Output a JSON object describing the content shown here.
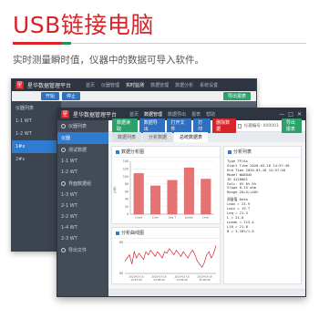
{
  "header": {
    "headline": "USB链接电脑",
    "subline": "实时测量瞬时值，仪器中的数据可导入软件。"
  },
  "colors": {
    "accent_red": "#d7242a",
    "accent_green": "#2a8f55",
    "panel_blue": "#2e7bcf",
    "bar_fill": "#e57373"
  },
  "back_window": {
    "title": "星华数据管理平台",
    "menu": [
      "首页",
      "仪器管理",
      "实时监测",
      "数据管理",
      "数据分析",
      "系统设置"
    ],
    "toolbar": [
      "开始",
      "停止"
    ],
    "sidebar": [
      "仪器列表",
      "1-1 WT",
      "1-2 WT",
      "1#x",
      "2#x"
    ],
    "right_button": "导出报表"
  },
  "front_window": {
    "title": "星华数据管理平台",
    "menu": [
      "首页",
      "数据管理",
      "数据导出",
      "报表",
      "帮助"
    ],
    "win_controls": [
      "—",
      "□",
      "✕"
    ],
    "sidebar": [
      "仪器列表",
      "仪器",
      "测试数据",
      "1-1 WT",
      "1-2 WT",
      "界面数据组",
      "1-3 WT",
      "2-1 WT",
      "2-2 WT",
      "1-4 WT",
      "2-3 WT",
      "导出文件"
    ],
    "toolbar": {
      "buttons": [
        "数据读取",
        "数据导出",
        "打开文件",
        "打印",
        "删除数据"
      ],
      "right_field": "仪器编号: 000001",
      "right_button": "导出报表"
    },
    "tabs": [
      "数据列表",
      "分析数据",
      "总统数据表"
    ],
    "bar_panel_title": "数据分析图",
    "line_panel_title": "分析曲线图",
    "analysis_panel_title": "分析列表",
    "analysis_lines": [
      "Type TP/Ax",
      "Start Time 2020-03-16 14:57:48",
      "End Time 2020-03-16 14:57:48",
      "Model WA8045",
      "ID 4120001",
      "Calc. 0%   0% 0%",
      "Slope 0.15 ohm",
      "Range 20+5/+40%",
      "",
      "测量值 Data",
      "Lmax    = 23.9",
      "Lmin    = 19.7",
      "Leq     = 21.3",
      "L       = 21.0",
      "Lpeak   = 113.4",
      "L10     = 21.8",
      "B       = 3.10%/1.6"
    ]
  },
  "chart_data": [
    {
      "type": "bar",
      "categories": [
        "Lmax",
        "Lmin",
        "Leq T",
        "Lpeak",
        "Lmin"
      ],
      "values": [
        108,
        75,
        90,
        123,
        93
      ],
      "ylim": [
        0,
        140
      ],
      "yticks": [
        0,
        20,
        40,
        60,
        80,
        100,
        120,
        140
      ],
      "ylabel": "(dB)",
      "grid": true
    },
    {
      "type": "line",
      "series": [
        {
          "values": [
            68,
            70,
            72,
            66,
            74,
            70,
            73,
            71,
            69,
            74,
            72,
            75,
            73,
            71,
            74,
            72,
            70,
            74,
            73,
            76,
            74,
            72,
            75,
            73,
            71,
            74,
            72,
            70,
            73,
            75,
            72,
            68,
            66,
            64,
            67,
            72,
            74,
            70,
            73,
            78
          ]
        }
      ],
      "ylim": [
        60,
        80
      ],
      "yticks": [
        80,
        60
      ],
      "xlabels": [
        "2020-03-16\n14:57:00",
        "2020-03-16\n14:58:00",
        "2020-03-16\n14:59:00",
        "2020-03-16\n15:00:00"
      ]
    }
  ]
}
